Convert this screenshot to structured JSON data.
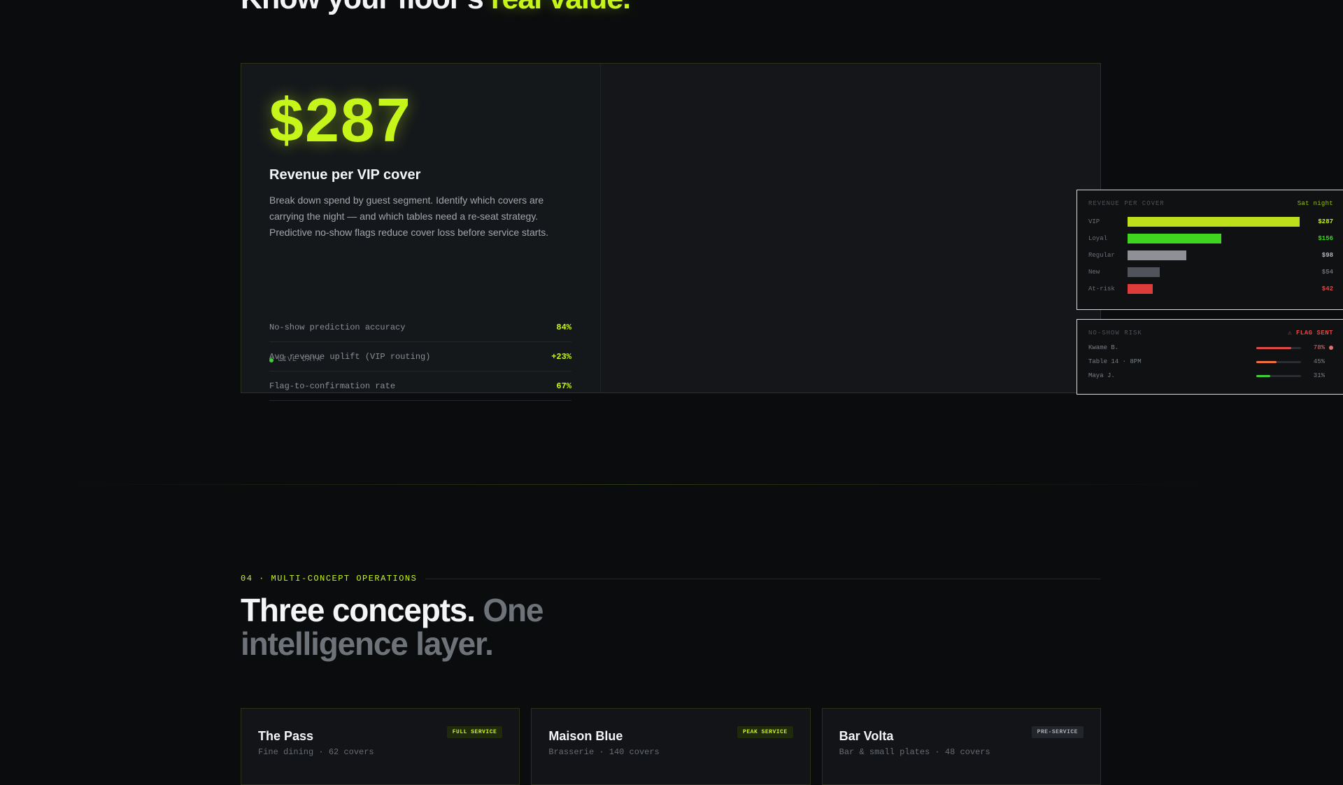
{
  "hero": {
    "title_main": "Know your floor's ",
    "title_accent": "real value."
  },
  "metric": {
    "value": "$287",
    "title": "Revenue per VIP cover",
    "description": "Break down spend by guest segment. Identify which covers are carrying the night — and which tables need a re-seat strategy. Predictive no-show flags reduce cover loss before service starts.",
    "stats": [
      {
        "label": "No-show prediction accuracy",
        "value": "84%"
      },
      {
        "label": "Avg revenue uplift (VIP routing)",
        "value": "+23%"
      },
      {
        "label": "Flag-to-confirmation rate",
        "value": "67%"
      }
    ],
    "live_label": "LIVE DATA"
  },
  "revenue_widget": {
    "label": "REVENUE PER COVER",
    "tag": "Sat night",
    "max": 287,
    "rows": [
      {
        "segment": "VIP",
        "amount": 287,
        "display": "$287",
        "color": "#bde01a",
        "value_color": "#c6f51a"
      },
      {
        "segment": "Loyal",
        "amount": 156,
        "display": "$156",
        "color": "#3fd41e",
        "value_color": "#3fd41e"
      },
      {
        "segment": "Regular",
        "amount": 98,
        "display": "$98",
        "color": "#8e9096",
        "value_color": "#b3b6bb"
      },
      {
        "segment": "New",
        "amount": 54,
        "display": "$54",
        "color": "#50535a",
        "value_color": "#6a6e74"
      },
      {
        "segment": "At-risk",
        "amount": 42,
        "display": "$42",
        "color": "#de3b3b",
        "value_color": "#e64545"
      }
    ]
  },
  "noshow_widget": {
    "label": "NO-SHOW RISK",
    "flag_icon": "⚠",
    "flag": "FLAG SENT",
    "rows": [
      {
        "name": "Kwame B.",
        "risk": 78,
        "display": "78%",
        "color": "#e34848",
        "value_color": "#e37070",
        "flagged": true
      },
      {
        "name": "Table 14 · 8PM",
        "risk": 45,
        "display": "45%",
        "color": "#f07040",
        "value_color": "#7a7f86",
        "flagged": false
      },
      {
        "name": "Maya J.",
        "risk": 31,
        "display": "31%",
        "color": "#3fcf3a",
        "value_color": "#7a7f86",
        "flagged": false
      }
    ]
  },
  "section": {
    "eyebrow": "04 · MULTI-CONCEPT OPERATIONS",
    "title_main": "Three concepts. ",
    "title_muted": "One intelligence layer."
  },
  "cards": [
    {
      "name": "The Pass",
      "sub": "Fine dining · 62 covers",
      "badge": "FULL SERVICE",
      "badge_style": "green"
    },
    {
      "name": "Maison Blue",
      "sub": "Brasserie · 140 covers",
      "badge": "PEAK SERVICE",
      "badge_style": "green"
    },
    {
      "name": "Bar Volta",
      "sub": "Bar & small plates · 48 covers",
      "badge": "PRE-SERVICE",
      "badge_style": "gray"
    }
  ]
}
